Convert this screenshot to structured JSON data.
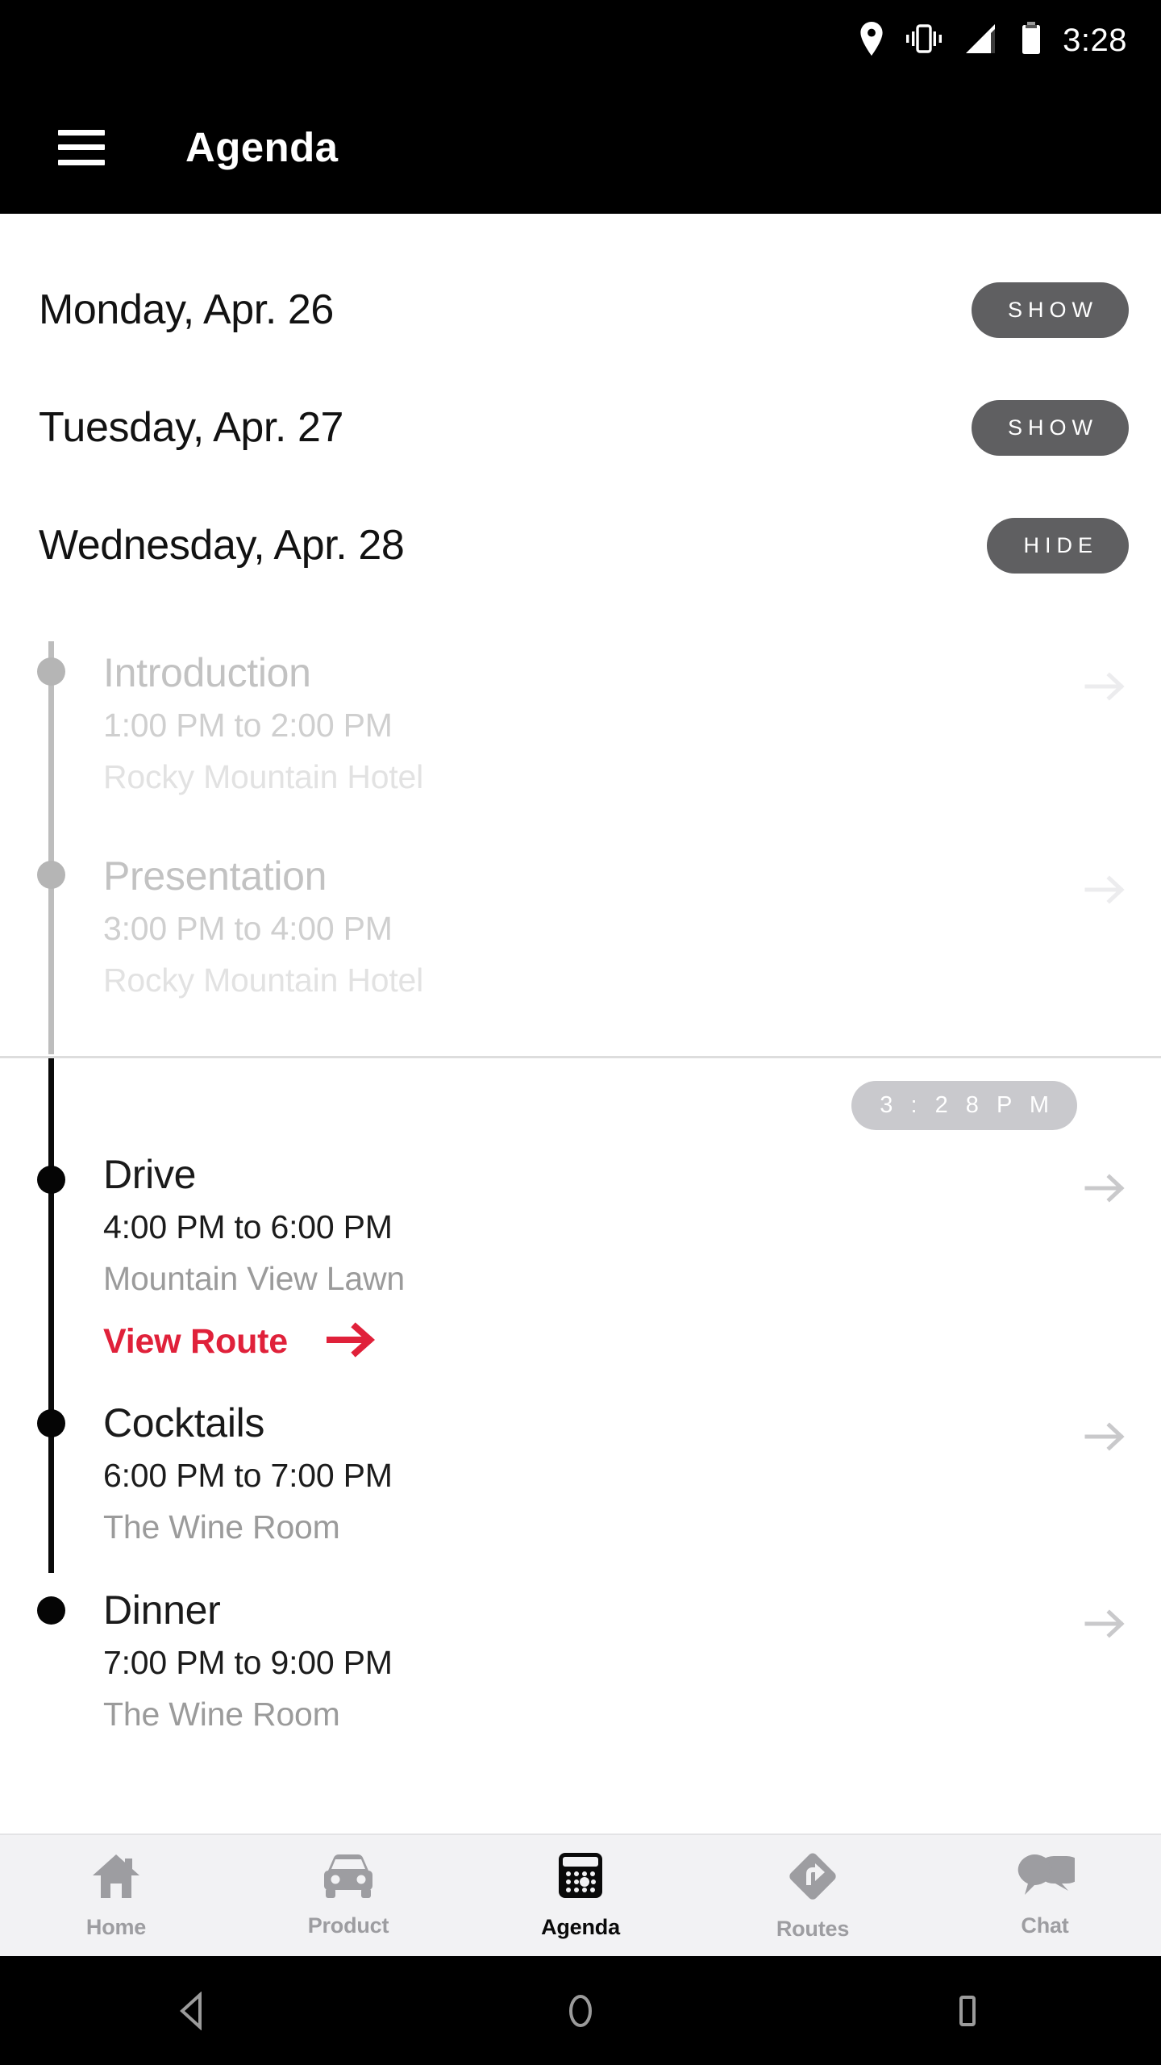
{
  "status_bar": {
    "time": "3:28",
    "icons": [
      "location-pin-icon",
      "vibrate-icon",
      "signal-icon",
      "battery-icon"
    ]
  },
  "app_bar": {
    "menu_icon": "hamburger-menu-icon",
    "title": "Agenda"
  },
  "days": [
    {
      "label": "Monday, Apr. 26",
      "toggle": "SHOW",
      "expanded": false
    },
    {
      "label": "Tuesday, Apr. 27",
      "toggle": "SHOW",
      "expanded": false
    },
    {
      "label": "Wednesday, Apr. 28",
      "toggle": "HIDE",
      "expanded": true
    }
  ],
  "now_marker": {
    "time": "3 : 2 8   P M",
    "label": "3:28 PM"
  },
  "events": [
    {
      "title": "Introduction",
      "time": "1:00 PM to 2:00 PM",
      "place": "Rocky Mountain Hotel",
      "state": "past",
      "route_link": null
    },
    {
      "title": "Presentation",
      "time": "3:00 PM to 4:00 PM",
      "place": "Rocky Mountain Hotel",
      "state": "past",
      "route_link": null
    },
    {
      "title": "Drive",
      "time": "4:00 PM to 6:00 PM",
      "place": "Mountain View Lawn",
      "state": "current",
      "route_link": "View Route"
    },
    {
      "title": "Cocktails",
      "time": "6:00 PM to 7:00 PM",
      "place": "The Wine Room",
      "state": "upcoming",
      "route_link": null
    },
    {
      "title": "Dinner",
      "time": "7:00 PM to 9:00 PM",
      "place": "The Wine Room",
      "state": "upcoming",
      "route_link": null
    }
  ],
  "bottom_nav": [
    {
      "label": "Home",
      "icon": "home-icon",
      "active": false
    },
    {
      "label": "Product",
      "icon": "car-icon",
      "active": false
    },
    {
      "label": "Agenda",
      "icon": "calendar-icon",
      "active": true
    },
    {
      "label": "Routes",
      "icon": "turn-right-diamond-icon",
      "active": false
    },
    {
      "label": "Chat",
      "icon": "chat-bubbles-icon",
      "active": false
    }
  ],
  "system_nav": [
    {
      "name": "back",
      "icon": "back-triangle-icon"
    },
    {
      "name": "home",
      "icon": "home-circle-icon"
    },
    {
      "name": "recents",
      "icon": "recents-square-icon"
    }
  ],
  "colors": {
    "accent_red": "#e0213a",
    "pill_gray": "#5f5f61",
    "now_badge_gray": "#c9c9cd",
    "nav_bg": "#f2f2f4",
    "bar_black": "#000000"
  }
}
